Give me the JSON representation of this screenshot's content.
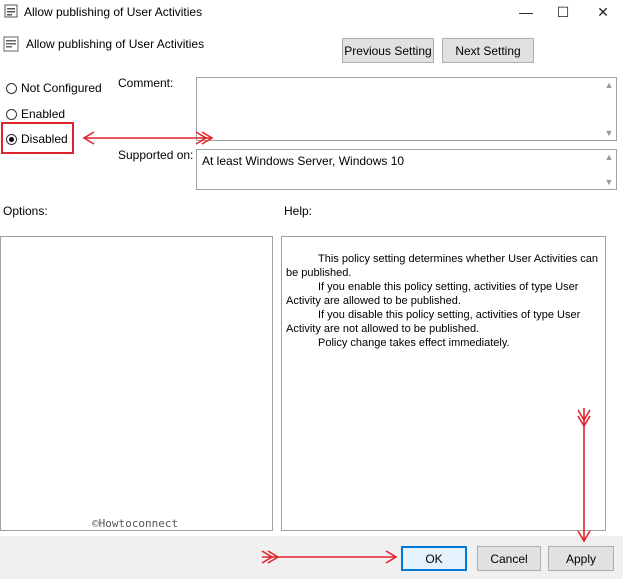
{
  "window": {
    "title": "Allow publishing of User Activities",
    "buttons": {
      "minimize": "—",
      "maximize": "☐",
      "close": "✕"
    }
  },
  "header": {
    "title": "Allow publishing of User Activities",
    "prev_label": "Previous Setting",
    "next_label": "Next Setting"
  },
  "radio_options": [
    {
      "label": "Not Configured",
      "checked": false
    },
    {
      "label": "Enabled",
      "checked": false
    },
    {
      "label": "Disabled",
      "checked": true
    }
  ],
  "comment": {
    "label": "Comment:",
    "value": ""
  },
  "supported_on": {
    "label": "Supported on:",
    "value": "At least Windows Server, Windows 10"
  },
  "options": {
    "label": "Options:"
  },
  "help": {
    "label": "Help:",
    "paragraphs": [
      "This policy setting determines whether User Activities can be published.",
      "If you enable this policy setting, activities of type User Activity are allowed to be published.",
      "If you disable this policy setting, activities of type User Activity are not allowed to be published.",
      "Policy change takes effect immediately."
    ]
  },
  "watermark": "©Howtoconnect",
  "footer": {
    "ok_label": "OK",
    "cancel_label": "Cancel",
    "apply_label": "Apply"
  },
  "colors": {
    "annotation": "#e0242b",
    "focus": "#0078d7"
  }
}
